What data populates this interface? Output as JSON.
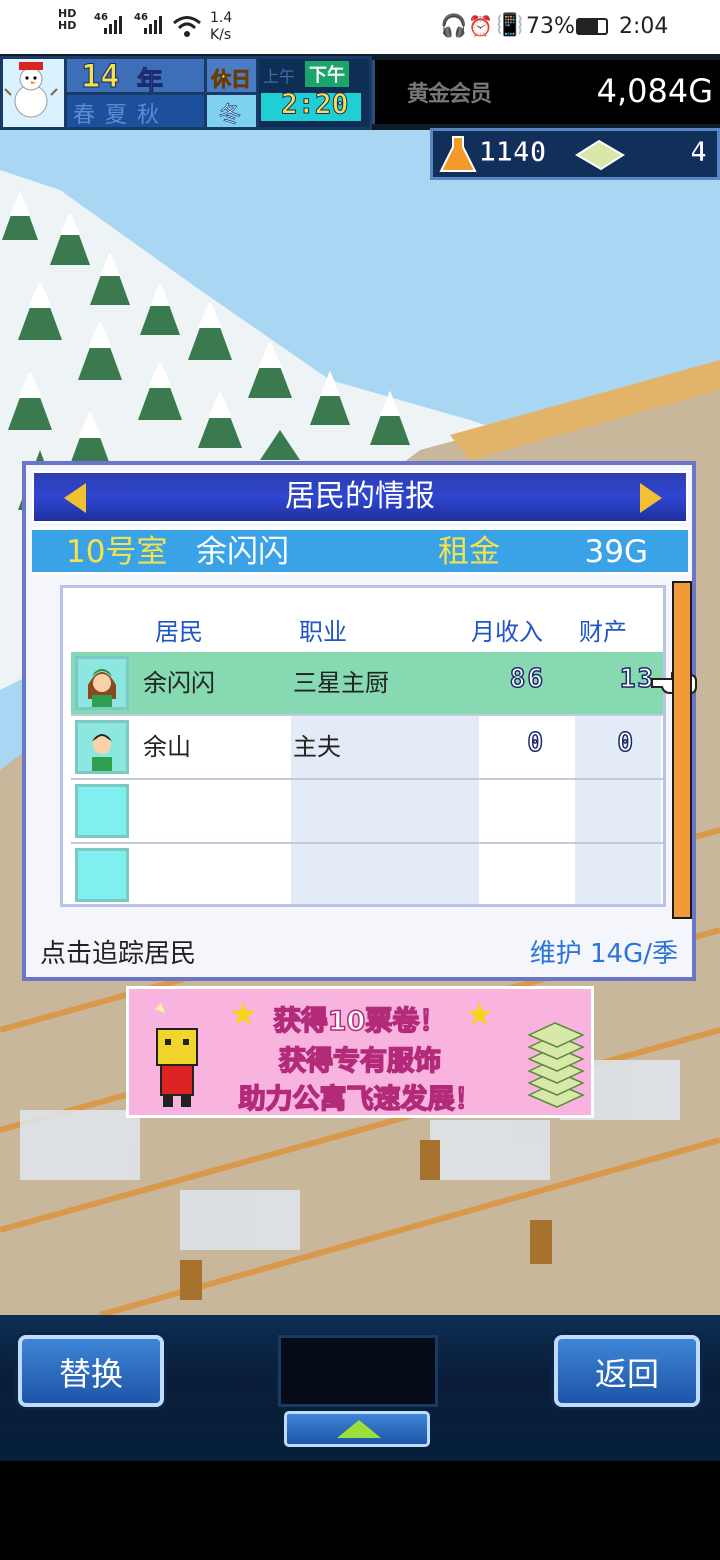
{
  "status_bar": {
    "hd1": "HD",
    "hd2": "HD",
    "net1": "46",
    "net2": "46",
    "speed_value": "1.4",
    "speed_unit": "K/s",
    "battery": "73%",
    "time": "2:04",
    "icons": [
      "headphones-icon",
      "alarm-icon",
      "vibrate-icon",
      "battery-icon",
      "wifi-icon",
      "signal-icon"
    ]
  },
  "hud": {
    "year": "14",
    "year_unit": "年",
    "holiday": "休日",
    "seasons": "春夏秋",
    "current_season": "冬",
    "am_label": "上午",
    "pm_label": "下午",
    "clock": "2:20",
    "membership": "黄金会员",
    "gold": "4,084G",
    "research_points": "1140",
    "tickets": "4"
  },
  "dialog": {
    "title": "居民的情报",
    "room": "10号室",
    "resident_name": "余闪闪",
    "rent_label": "租金",
    "rent_value": "39G",
    "columns": {
      "resident": "居民",
      "job": "职业",
      "income": "月收入",
      "assets": "财产"
    },
    "rows": [
      {
        "name": "余闪闪",
        "job": "三星主厨",
        "income": "86",
        "assets": "13",
        "selected": true
      },
      {
        "name": "余山",
        "job": "主夫",
        "income": "0",
        "assets": "0",
        "selected": false
      },
      {
        "name": "",
        "job": "",
        "income": "",
        "assets": "",
        "selected": false
      },
      {
        "name": "",
        "job": "",
        "income": "",
        "assets": "",
        "selected": false
      }
    ],
    "footer_left": "点击追踪居民",
    "footer_right": "维护 14G/季"
  },
  "banner": {
    "line1": "获得10票卷！",
    "line2": "获得专有服饰",
    "line3": "助力公寓飞速发展！"
  },
  "bottom_bar": {
    "swap_label": "替换",
    "back_label": "返回"
  },
  "colors": {
    "dialog_title_bg": "#2e46d0",
    "room_bar_bg": "#3aa3e8",
    "selected_row": "#86d9b1",
    "gold_text": "#f5e24a",
    "accent_blue": "#2a74d9",
    "scroll_orange": "#f29a3a"
  }
}
